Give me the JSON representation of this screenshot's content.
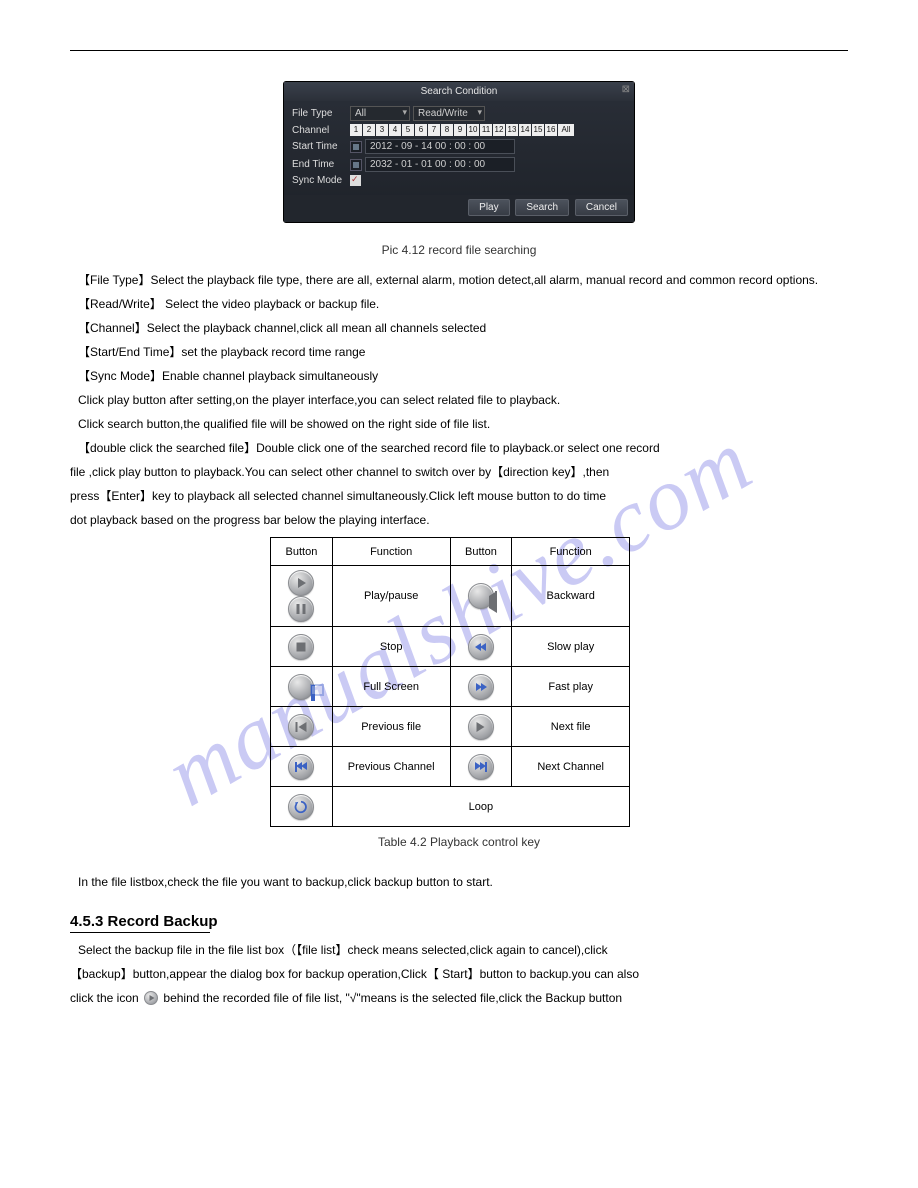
{
  "watermark": "manualshive.com",
  "dialog": {
    "title": "Search Condition",
    "labels": {
      "file_type": "File Type",
      "channel": "Channel",
      "start_time": "Start Time",
      "end_time": "End Time",
      "sync_mode": "Sync Mode"
    },
    "file_type_value": "All",
    "rw_value": "Read/Write",
    "channels": [
      "1",
      "2",
      "3",
      "4",
      "5",
      "6",
      "7",
      "8",
      "9",
      "10",
      "11",
      "12",
      "13",
      "14",
      "15",
      "16"
    ],
    "channel_all": "All",
    "start_time": "2012 - 09 - 14  00 : 00 : 00",
    "end_time": "2032 - 01 - 01  00 : 00 : 00",
    "buttons": {
      "play": "Play",
      "search": "Search",
      "cancel": "Cancel"
    }
  },
  "fig1": {
    "caption": "Pic 4.12 record file searching"
  },
  "text1": "【File Type】Select the playback file type, there are all, external alarm, motion detect,all alarm, manual record and common record options.",
  "text2": "【Read/Write】 Select the video playback or backup file.",
  "text3": "【Channel】Select the playback channel,click all mean all channels selected",
  "text4": "【Start/End Time】set the playback record time range",
  "text5": "【Sync Mode】Enable channel playback simultaneously",
  "text6": "Click play button after setting,on the player interface,you can select related file to playback.",
  "text7": "Click search button,the qualified file will be showed on the right side of  file list.",
  "text8": "【double click the searched file】Double click one of the searched record file to playback.or select one record",
  "text9": "file ,click play button to playback.You can select other channel to switch over by【direction key】,then",
  "text10": "press【Enter】key to  playback all selected channel simultaneously.Click left mouse button to do time",
  "text11": "dot playback based on the progress bar below the playing interface.",
  "table_hdr": {
    "c1": "Button",
    "c2": "Function",
    "c3": "Button",
    "c4": "Function"
  },
  "table": {
    "r1f1": "Play/pause",
    "r1f2": "Backward",
    "r2f1": "Stop",
    "r2f2": "Slow play",
    "r3f1": "Full Screen",
    "r3f2": "Fast play",
    "r4f1": "Previous file",
    "r4f2": "Next file",
    "r5f1": "Previous Channel",
    "r5f2": "Next Channel",
    "r6f1": "Loop"
  },
  "table_caption": "Table 4.2 Playback control key",
  "text12": "In the file listbox,check the file you want to backup,click backup button to start.",
  "section": "4.5.3 Record Backup",
  "text13": "Select the backup file in the file list box（【file list】check means selected,click again to cancel),click",
  "text14": "【backup】button,appear the dialog box for backup operation,Click【 Start】button to backup.you can also",
  "text15": "click the icon",
  "text15b": "behind the recorded file of file list, \"√\"means is the selected file,click the Backup button"
}
